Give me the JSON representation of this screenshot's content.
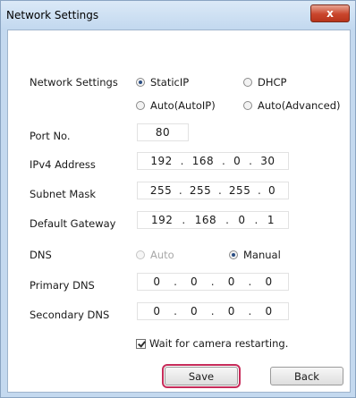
{
  "window": {
    "title": "Network Settings",
    "close_glyph": "x"
  },
  "network": {
    "label": "Network Settings",
    "options": [
      {
        "label": "StaticIP",
        "selected": true
      },
      {
        "label": "DHCP",
        "selected": false
      },
      {
        "label": "Auto(AutoIP)",
        "selected": false
      },
      {
        "label": "Auto(Advanced)",
        "selected": false
      }
    ]
  },
  "port": {
    "label": "Port No.",
    "value": "80"
  },
  "ipv4": {
    "label": "IPv4 Address",
    "octets": [
      "192",
      "168",
      "0",
      "30"
    ]
  },
  "subnet": {
    "label": "Subnet Mask",
    "octets": [
      "255",
      "255",
      "255",
      "0"
    ]
  },
  "gateway": {
    "label": "Default Gateway",
    "octets": [
      "192",
      "168",
      "0",
      "1"
    ]
  },
  "dns": {
    "label": "DNS",
    "auto": {
      "label": "Auto",
      "selected": false,
      "disabled": true
    },
    "manual": {
      "label": "Manual",
      "selected": true
    }
  },
  "primary_dns": {
    "label": "Primary DNS",
    "octets": [
      "0",
      "0",
      "0",
      "0"
    ]
  },
  "secondary_dns": {
    "label": "Secondary DNS",
    "octets": [
      "0",
      "0",
      "0",
      "0"
    ]
  },
  "wait_restart": {
    "label": "Wait for camera restarting.",
    "checked": true
  },
  "buttons": {
    "save": "Save",
    "back": "Back"
  },
  "separator": ".",
  "colors": {
    "save_highlight": "#c72c5a",
    "title_bar": "#c4d9ef",
    "close_button": "#c9452c"
  }
}
